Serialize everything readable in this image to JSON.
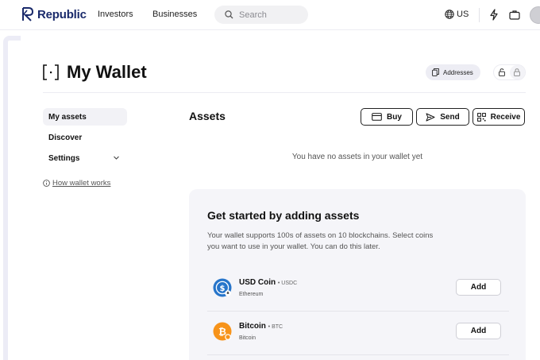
{
  "nav": {
    "brand": "Republic",
    "links": [
      "Investors",
      "Businesses"
    ],
    "search_placeholder": "Search",
    "locale": "US",
    "icons": [
      "globe-icon",
      "lightning-icon",
      "briefcase-icon"
    ]
  },
  "header": {
    "title": "My Wallet",
    "addresses_label": "Addresses"
  },
  "sidebar": {
    "items": [
      {
        "label": "My assets",
        "active": true
      },
      {
        "label": "Discover",
        "active": false
      },
      {
        "label": "Settings",
        "active": false
      }
    ],
    "help_link": "How wallet works"
  },
  "assets": {
    "title": "Assets",
    "buttons": {
      "buy": "Buy",
      "send": "Send",
      "receive": "Receive"
    },
    "empty_message": "You have no assets in your wallet yet"
  },
  "get_started": {
    "title": "Get started by adding assets",
    "description": "Your wallet supports 100s of assets on 10 blockchains. Select coins you want to use in your wallet. You can do this later.",
    "coins": [
      {
        "name": "USD Coin",
        "ticker": "• USDC",
        "network": "Ethereum",
        "add_label": "Add",
        "color": "#2775ca"
      },
      {
        "name": "Bitcoin",
        "ticker": "• BTC",
        "network": "Bitcoin",
        "add_label": "Add",
        "color": "#f7931a"
      }
    ]
  },
  "colors": {
    "brand": "#1a2a6b",
    "accent_bg": "#ededf4",
    "card_bg": "#f5f5f9"
  }
}
